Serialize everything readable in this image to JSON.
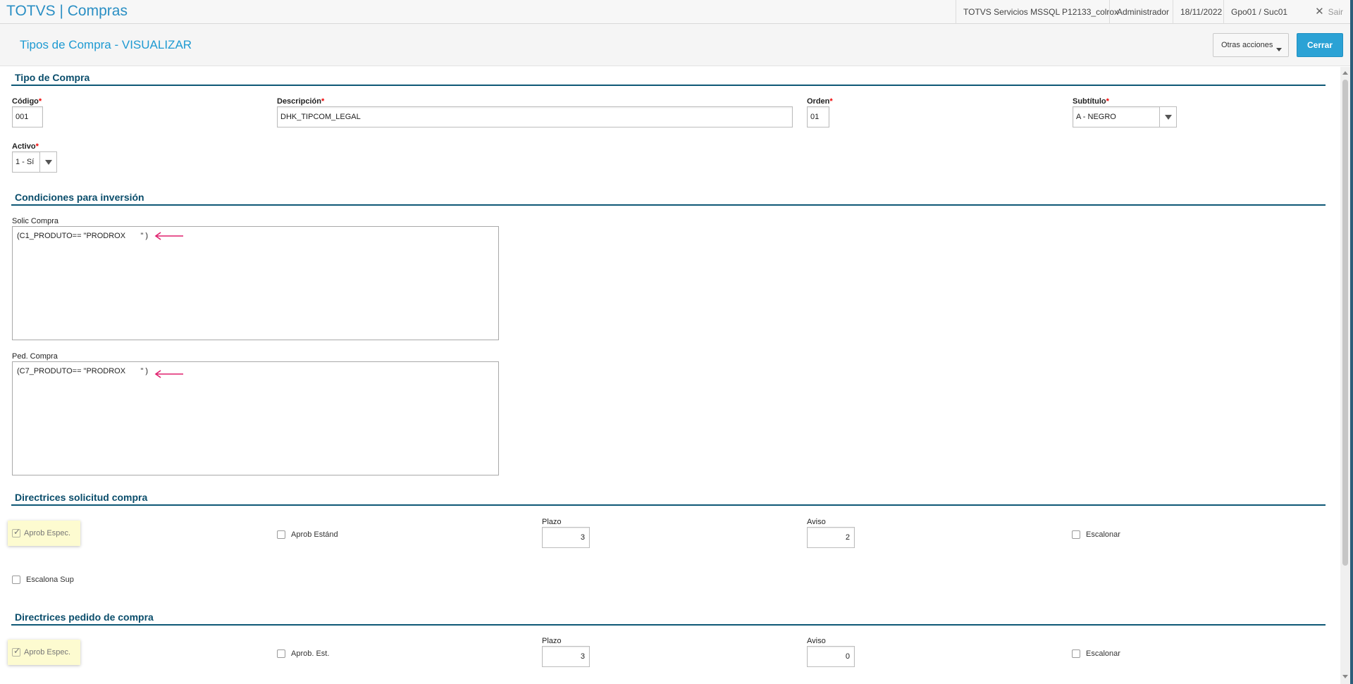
{
  "topbar": {
    "app_title": "TOTVS | Compras",
    "environment": "TOTVS Servicios MSSQL P12133_colrox",
    "user": "Administrador",
    "date": "18/11/2022",
    "branch": "Gpo01 / Suc01",
    "exit_label": "Sair"
  },
  "header": {
    "page_title": "Tipos de Compra - VISUALIZAR",
    "otras_acciones": "Otras acciones",
    "cerrar": "Cerrar"
  },
  "sections": {
    "tipo_compra": "Tipo de Compra",
    "condiciones": "Condiciones para inversión",
    "dir_solicitud": "Directrices solicitud compra",
    "dir_pedido": "Directrices pedido de compra"
  },
  "tipo_compra": {
    "codigo_label": "Código",
    "codigo_value": "001",
    "descripcion_label": "Descripción",
    "descripcion_value": "DHK_TIPCOM_LEGAL",
    "orden_label": "Orden",
    "orden_value": "01",
    "subtitulo_label": "Subtítulo",
    "subtitulo_value": "A - NEGRO",
    "activo_label": "Activo",
    "activo_value": "1 - Sí",
    "required_mark": "*"
  },
  "condiciones": {
    "solic_label": "Solic Compra",
    "solic_value": "(C1_PRODUTO== \"PRODROX       \" )",
    "ped_label": "Ped. Compra",
    "ped_value": "(C7_PRODUTO== \"PRODROX       \" )",
    "arrow_color": "#e0206e"
  },
  "dir_solicitud": {
    "aprob_espec": "Aprob Espec.",
    "aprob_estand": "Aprob Estánd",
    "plazo_label": "Plazo",
    "plazo_value": "3",
    "aviso_label": "Aviso",
    "aviso_value": "2",
    "escalonar": "Escalonar",
    "escalona_sup": "Escalona Sup"
  },
  "dir_pedido": {
    "aprob_espec": "Aprob Espec.",
    "aprob_est": "Aprob. Est.",
    "plazo_label": "Plazo",
    "plazo_value": "3",
    "aviso_label": "Aviso",
    "aviso_value": "0",
    "escalonar": "Escalonar"
  },
  "glyphs": {
    "check": "✓",
    "close": "✕"
  }
}
